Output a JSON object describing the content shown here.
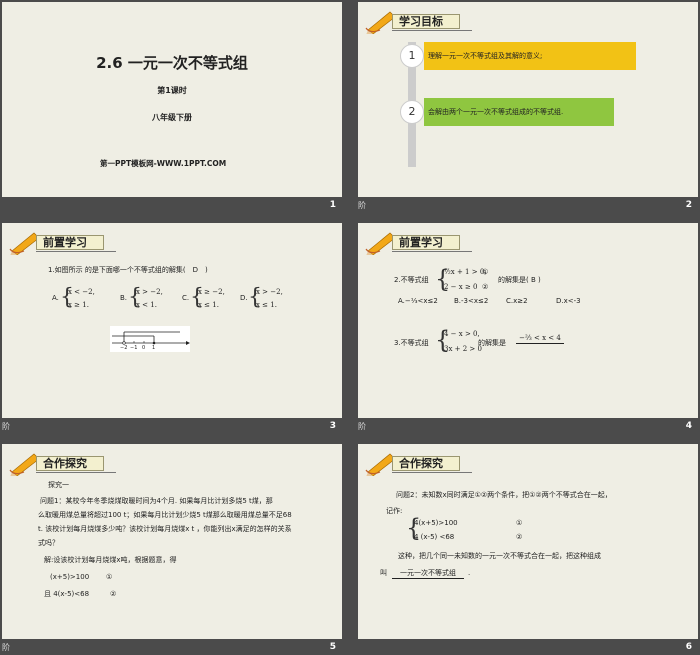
{
  "slides": [
    {
      "num": "1",
      "title": "2.6  一元一次不等式组",
      "lesson": "第1课时",
      "grade": "八年级下册",
      "site": "第一PPT模板网-WWW.1PPT.COM"
    },
    {
      "num": "2",
      "footer_left": "阶",
      "header": "学习目标",
      "goals": [
        {
          "n": "1",
          "text": "理解一元一次不等式组及其解的意义;"
        },
        {
          "n": "2",
          "text": "会解由两个一元一次不等式组成的不等式组."
        }
      ],
      "goal_colors": [
        "#f2c215",
        "#8fc640"
      ]
    },
    {
      "num": "3",
      "footer_left": "阶",
      "header": "前置学习",
      "question": "1.如图所示 的是下面哪一个不等式组的解集(　D　)",
      "options": [
        {
          "label": "A.",
          "l1": "x < −2,",
          "l2": "x ≥ 1."
        },
        {
          "label": "B.",
          "l1": "x > −2,",
          "l2": "x < 1."
        },
        {
          "label": "C.",
          "l1": "x ≥ −2,",
          "l2": "x ≤ 1."
        },
        {
          "label": "D.",
          "l1": "x > −2,",
          "l2": "x ≤ 1."
        }
      ],
      "axis_ticks": [
        "−2",
        "−1",
        "0",
        "1"
      ]
    },
    {
      "num": "4",
      "footer_left": "阶",
      "header": "前置学习",
      "q2_prefix": "2.不等式组",
      "q2_l1": "½x + 1 > 0,",
      "q2_l2": "2 − x ≥ 0",
      "q2_m1": "①",
      "q2_m2": "②",
      "q2_suffix": "的解集是(  B  )",
      "q2_options": [
        "A.−⅓<x≤2",
        "B.-3<x≤2",
        "C.x≥2",
        "D.x<-3"
      ],
      "q3_prefix": "3.不等式组",
      "q3_l1": "4 − x > 0,",
      "q3_l2": "3x + 2 > 0",
      "q3_suffix": "的解集是",
      "q3_answer": "−⅔ < x < 4"
    },
    {
      "num": "5",
      "footer_left": "阶",
      "header": "合作探究",
      "lines": [
        "探究一",
        "问题1：某校今年冬季烧煤取暖时间为4个月. 如果每月比计划多烧5  t煤，那",
        "么取暖用煤总量将超过100 t；如果每月比计划少烧5  t煤那么取暖用煤总量不足68",
        "t. 该校计划每月烧煤多少吨？该校计划每月烧煤x  t ，你能列出x满足的怎样的关系",
        "式吗？",
        "解:设该校计划每月烧煤x吨，根据题意，得"
      ],
      "eq1": "(x+5)>100",
      "eq1_mark": "①",
      "eq2": "且 4(x-5)<68",
      "eq2_mark": "②"
    },
    {
      "num": "6",
      "header": "合作探究",
      "l1": "问题2：未知数x同时满足①②两个条件，把①②两个不等式合在一起，",
      "l2": "记作:",
      "sys1": "4(x+5)>100",
      "sys2": "4 (x-5) <68",
      "m1": "①",
      "m2": "②",
      "l3": "这种，把几个同一未知数的一元一次不等式合在一起，把这种组成",
      "l4_prefix": "叫",
      "l4_answer": "一元一次不等式组",
      "l4_suffix": "."
    }
  ]
}
